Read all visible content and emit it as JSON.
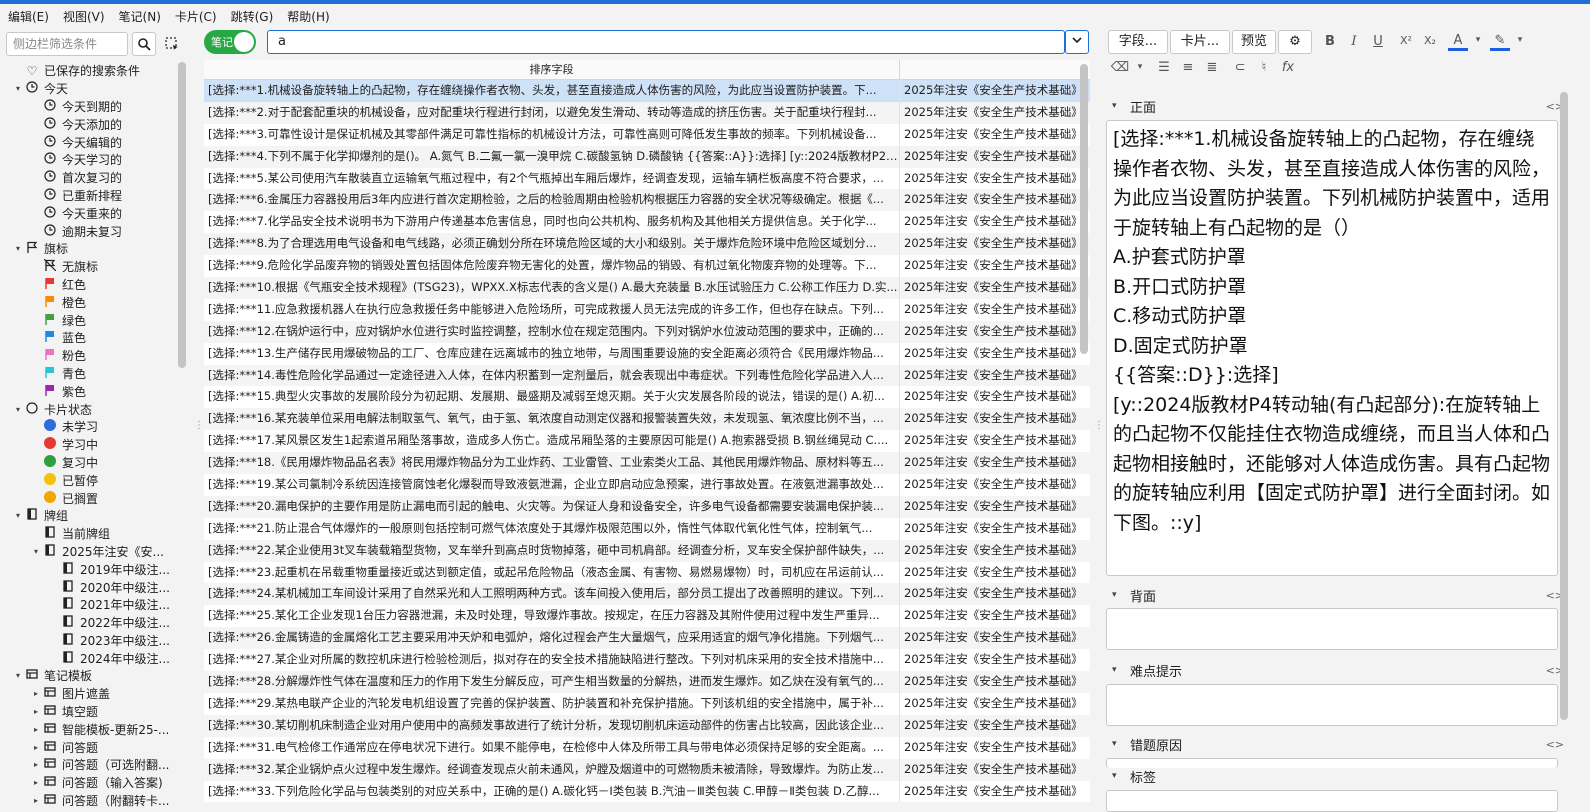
{
  "menu": [
    "编辑(E)",
    "视图(V)",
    "笔记(N)",
    "卡片(C)",
    "跳转(G)",
    "帮助(H)"
  ],
  "sidebar": {
    "search_placeholder": "侧边栏筛选条件",
    "items": [
      {
        "label": "已保存的搜索条件",
        "indent": 0,
        "arrow": "",
        "icon": "heart-icon"
      },
      {
        "label": "今天",
        "indent": 0,
        "arrow": "▾",
        "icon": "clock-icon"
      },
      {
        "label": "今天到期的",
        "indent": 1,
        "arrow": "",
        "icon": "clock-icon"
      },
      {
        "label": "今天添加的",
        "indent": 1,
        "arrow": "",
        "icon": "clock-icon"
      },
      {
        "label": "今天编辑的",
        "indent": 1,
        "arrow": "",
        "icon": "clock-icon"
      },
      {
        "label": "今天学习的",
        "indent": 1,
        "arrow": "",
        "icon": "clock-icon"
      },
      {
        "label": "首次复习的",
        "indent": 1,
        "arrow": "",
        "icon": "clock-icon"
      },
      {
        "label": "已重新排程",
        "indent": 1,
        "arrow": "",
        "icon": "clock-icon"
      },
      {
        "label": "今天重来的",
        "indent": 1,
        "arrow": "",
        "icon": "clock-icon"
      },
      {
        "label": "逾期未复习",
        "indent": 1,
        "arrow": "",
        "icon": "clock-icon"
      },
      {
        "label": "旗标",
        "indent": 0,
        "arrow": "▾",
        "icon": "flag-icon"
      },
      {
        "label": "无旗标",
        "indent": 1,
        "arrow": "",
        "icon": "no-flag-icon"
      },
      {
        "label": "红色",
        "indent": 1,
        "arrow": "",
        "icon": "red-flag-icon"
      },
      {
        "label": "橙色",
        "indent": 1,
        "arrow": "",
        "icon": "orange-flag-icon"
      },
      {
        "label": "绿色",
        "indent": 1,
        "arrow": "",
        "icon": "green-flag-icon"
      },
      {
        "label": "蓝色",
        "indent": 1,
        "arrow": "",
        "icon": "blue-flag-icon"
      },
      {
        "label": "粉色",
        "indent": 1,
        "arrow": "",
        "icon": "pink-flag-icon"
      },
      {
        "label": "青色",
        "indent": 1,
        "arrow": "",
        "icon": "cyan-flag-icon"
      },
      {
        "label": "紫色",
        "indent": 1,
        "arrow": "",
        "icon": "purple-flag-icon"
      },
      {
        "label": "卡片状态",
        "indent": 0,
        "arrow": "▾",
        "icon": "circle-icon"
      },
      {
        "label": "未学习",
        "indent": 1,
        "arrow": "",
        "icon": "blue-dot-icon"
      },
      {
        "label": "学习中",
        "indent": 1,
        "arrow": "",
        "icon": "red-dot-icon"
      },
      {
        "label": "复习中",
        "indent": 1,
        "arrow": "",
        "icon": "green-dot-icon"
      },
      {
        "label": "已暂停",
        "indent": 1,
        "arrow": "",
        "icon": "yellow-dot-icon"
      },
      {
        "label": "已搁置",
        "indent": 1,
        "arrow": "",
        "icon": "amber-dot-icon"
      },
      {
        "label": "牌组",
        "indent": 0,
        "arrow": "▾",
        "icon": "deck-icon"
      },
      {
        "label": "当前牌组",
        "indent": 1,
        "arrow": "",
        "icon": "deck-icon"
      },
      {
        "label": "2025年注安《安...",
        "indent": 1,
        "arrow": "▾",
        "icon": "deck-icon"
      },
      {
        "label": "2019年中级注...",
        "indent": 2,
        "arrow": "",
        "icon": "deck-icon"
      },
      {
        "label": "2020年中级注...",
        "indent": 2,
        "arrow": "",
        "icon": "deck-icon"
      },
      {
        "label": "2021年中级注...",
        "indent": 2,
        "arrow": "",
        "icon": "deck-icon"
      },
      {
        "label": "2022年中级注...",
        "indent": 2,
        "arrow": "",
        "icon": "deck-icon"
      },
      {
        "label": "2023年中级注...",
        "indent": 2,
        "arrow": "",
        "icon": "deck-icon"
      },
      {
        "label": "2024年中级注...",
        "indent": 2,
        "arrow": "",
        "icon": "deck-icon"
      },
      {
        "label": "笔记模板",
        "indent": 0,
        "arrow": "▾",
        "icon": "notetype-icon"
      },
      {
        "label": "图片遮盖",
        "indent": 1,
        "arrow": "▸",
        "icon": "notetype-icon"
      },
      {
        "label": "填空题",
        "indent": 1,
        "arrow": "▸",
        "icon": "notetype-icon"
      },
      {
        "label": "智能模板-更新25-...",
        "indent": 1,
        "arrow": "▸",
        "icon": "notetype-icon"
      },
      {
        "label": "问答题",
        "indent": 1,
        "arrow": "▸",
        "icon": "notetype-icon"
      },
      {
        "label": "问答题（可选附翻...",
        "indent": 1,
        "arrow": "▸",
        "icon": "notetype-icon"
      },
      {
        "label": "问答题（输入答案)",
        "indent": 1,
        "arrow": "▸",
        "icon": "notetype-icon"
      },
      {
        "label": "问答题（附翻转卡...",
        "indent": 1,
        "arrow": "▸",
        "icon": "notetype-icon"
      }
    ]
  },
  "toggle_label": "笔记",
  "search_value": "a",
  "table": {
    "header_sort_field": "排序字段",
    "rows": [
      {
        "field": "[选择:***1.机械设备旋转轴上的凸起物，存在缠绕操作者衣物、头发，甚至直接造成人体伤害的风险，为此应当设置防护装置。下...",
        "deck": "2025年注安《安全生产技术基础》"
      },
      {
        "field": "[选择:***2.对于配套配重块的机械设备，应对配重块行程进行封闭，以避免发生滑动、转动等造成的挤压伤害。关于配重块行程封...",
        "deck": "2025年注安《安全生产技术基础》"
      },
      {
        "field": "[选择:***3.可靠性设计是保证机械及其零部件满足可靠性指标的机械设计方法，可靠性高则可降低发生事故的频率。下列机械设备...",
        "deck": "2025年注安《安全生产技术基础》"
      },
      {
        "field": "[选择:***4.下列不属于化学抑爆剂的是()。 A.氮气 B.二氟一氯一溴甲烷 C.碳酸氢钠 D.磷酸钠 {{答案::A}}:选择] [y::2024版教材P284...",
        "deck": "2025年注安《安全生产技术基础》"
      },
      {
        "field": "[选择:***5.某公司使用汽车散装直立运输氧气瓶过程中，有2个气瓶掉出车厢后爆炸，经调查发现，运输车辆栏板高度不符合要求，...",
        "deck": "2025年注安《安全生产技术基础》"
      },
      {
        "field": "[选择:***6.金属压力容器投用后3年内应进行首次定期检验，之后的检验周期由检验机构根据压力容器的安全状况等级确定。根据《...",
        "deck": "2025年注安《安全生产技术基础》"
      },
      {
        "field": "[选择:***7.化学品安全技术说明书为下游用户传递基本危害信息，同时也向公共机构、服务机构及其他相关方提供信息。关于化学...",
        "deck": "2025年注安《安全生产技术基础》"
      },
      {
        "field": "[选择:***8.为了合理选用电气设备和电气线路，必须正确划分所在环境危险区域的大小和级别。关于爆炸危险环境中危险区域划分...",
        "deck": "2025年注安《安全生产技术基础》"
      },
      {
        "field": "[选择:***9.危险化学品废弃物的销毁处置包括固体危险废弃物无害化的处置，爆炸物品的销毁、有机过氧化物废弃物的处理等。下...",
        "deck": "2025年注安《安全生产技术基础》"
      },
      {
        "field": "[选择:***10.根据《气瓶安全技术规程》(TSG23)，WPXX.X标志代表的含义是() A.最大充装量 B.水压试验压力 C.公称工作压力 D.实...",
        "deck": "2025年注安《安全生产技术基础》"
      },
      {
        "field": "[选择:***11.应急救援机器人在执行应急救援任务中能够进入危险场所，可完成救援人员无法完成的许多工作，但也存在缺点。下列...",
        "deck": "2025年注安《安全生产技术基础》"
      },
      {
        "field": "[选择:***12.在锅炉运行中，应对锅炉水位进行实时监控调整，控制水位在规定范围内。下列对锅炉水位波动范围的要求中，正确的...",
        "deck": "2025年注安《安全生产技术基础》"
      },
      {
        "field": "[选择:***13.生产储存民用爆破物品的工厂、仓库应建在远离城市的独立地带，与周围重要设施的安全距离必须符合《民用爆炸物品...",
        "deck": "2025年注安《安全生产技术基础》"
      },
      {
        "field": "[选择:***14.毒性危险化学品通过一定途径进入人体，在体内积蓄到一定剂量后，就会表现出中毒症状。下列毒性危险化学品进入人...",
        "deck": "2025年注安《安全生产技术基础》"
      },
      {
        "field": "[选择:***15.典型火灾事故的发展阶段分为初起期、发展期、最盛期及减弱至熄灭期。关于火灾发展各阶段的说法，错误的是() A.初...",
        "deck": "2025年注安《安全生产技术基础》"
      },
      {
        "field": "[选择:***16.某充装单位采用电解法制取氢气、氧气，由于氢、氧浓度自动测定仪器和报警装置失效，未发现氢、氧浓度比例不当，...",
        "deck": "2025年注安《安全生产技术基础》"
      },
      {
        "field": "[选择:***17.某风景区发生1起索道吊厢坠落事故，造成多人伤亡。造成吊厢坠落的主要原因可能是() A.抱索器受损 B.钢丝绳晃动 C....",
        "deck": "2025年注安《安全生产技术基础》"
      },
      {
        "field": "[选择:***18.《民用爆炸物品品名表》将民用爆炸物品分为工业炸药、工业雷管、工业索类火工品、其他民用爆炸物品、原材料等五...",
        "deck": "2025年注安《安全生产技术基础》"
      },
      {
        "field": "[选择:***19.某公司氯制冷系统因连接管腐蚀老化爆裂而导致液氨泄漏，企业立即启动应急预案，进行事故处置。在液氨泄漏事故处...",
        "deck": "2025年注安《安全生产技术基础》"
      },
      {
        "field": "[选择:***20.漏电保护的主要作用是防止漏电而引起的触电、火灾等。为保证人身和设备安全，许多电气设备都需要安装漏电保护装...",
        "deck": "2025年注安《安全生产技术基础》"
      },
      {
        "field": "[选择:***21.防止混合气体爆炸的一般原则包括控制可燃气体浓度处于其爆炸极限范围以外，惰性气体取代氧化性气体，控制氧气...",
        "deck": "2025年注安《安全生产技术基础》"
      },
      {
        "field": "[选择:***22.某企业使用3t叉车装载箱型货物，叉车举升到高点时货物掉落，砸中司机肩部。经调查分析，叉车安全保护部件缺失，...",
        "deck": "2025年注安《安全生产技术基础》"
      },
      {
        "field": "[选择:***23.起重机在吊载重物重量接近或达到额定值，或起吊危险物品（液态金属、有害物、易燃易爆物）时，司机应在吊运前认...",
        "deck": "2025年注安《安全生产技术基础》"
      },
      {
        "field": "[选择:***24.某机械加工车间设计采用了自然采光和人工照明两种方式。该车间投入使用后，部分员工提出了改善照明的建议。下列...",
        "deck": "2025年注安《安全生产技术基础》"
      },
      {
        "field": "[选择:***25.某化工企业发现1台压力容器泄漏，未及时处理，导致爆炸事故。按规定，在压力容器及其附件使用过程中发生严重异...",
        "deck": "2025年注安《安全生产技术基础》"
      },
      {
        "field": "[选择:***26.金属铸造的金属熔化工艺主要采用冲天炉和电弧炉，熔化过程会产生大量烟气，应采用适宜的烟气净化措施。下列烟气...",
        "deck": "2025年注安《安全生产技术基础》"
      },
      {
        "field": "[选择:***27.某企业对所属的数控机床进行检验检测后，拟对存在的安全技术措施缺陷进行整改。下列对机床采用的安全技术措施中...",
        "deck": "2025年注安《安全生产技术基础》"
      },
      {
        "field": "[选择:***28.分解爆炸性气体在温度和压力的作用下发生分解反应，可产生相当数量的分解热，进而发生爆炸。如乙炔在没有氧气的...",
        "deck": "2025年注安《安全生产技术基础》"
      },
      {
        "field": "[选择:***29.某热电联产企业的汽轮发电机组设置了完善的保护装置、防护装置和补充保护措施。下列该机组的安全措施中，属于补...",
        "deck": "2025年注安《安全生产技术基础》"
      },
      {
        "field": "[选择:***30.某切削机床制造企业对用户使用中的高频发事故进行了统计分析，发现切削机床运动部件的伤害占比较高，因此该企业...",
        "deck": "2025年注安《安全生产技术基础》"
      },
      {
        "field": "[选择:***31.电气检修工作通常应在停电状况下进行。如果不能停电，在检修中人体及所带工具与带电体必须保持足够的安全距离。...",
        "deck": "2025年注安《安全生产技术基础》"
      },
      {
        "field": "[选择:***32.某企业锅炉点火过程中发生爆炸。经调查发现点火前未通风，炉膛及烟道中的可燃物质未被清除，导致爆炸。为防止发...",
        "deck": "2025年注安《安全生产技术基础》"
      },
      {
        "field": "[选择:***33.下列危险化学品与包装类别的对应关系中，正确的是() A.碳化钙－Ⅰ类包装 B.汽油－Ⅲ类包装 C.甲醇－Ⅱ类包装 D.乙醇...",
        "deck": "2025年注安《安全生产技术基础》"
      },
      {
        "field": "",
        "deck": ""
      }
    ]
  },
  "editor": {
    "buttons": {
      "fields": "字段...",
      "cards": "卡片...",
      "preview": "预览"
    },
    "fields": {
      "front": {
        "label": "正面",
        "content": [
          "[选择:***1.机械设备旋转轴上的凸起物，存在缠绕操作者衣物、头发，甚至直接造成人体伤害的风险，为此应当设置防护装置。下列机械防护装置中，适用于旋转轴上有凸起物的是（）",
          "A.护套式防护罩",
          "B.开口式防护罩",
          "C.移动式防护罩",
          "D.固定式防护罩",
          "{{答案::D}}:选择]",
          "[y::2024版教材P4转动轴(有凸起部分):在旋转轴上的凸起物不仅能挂住衣物造成缠绕，而且当人体和凸起物相接触时，还能够对人体造成伤害。具有凸起物的旋转轴应利用【固定式防护罩】进行全面封闭。如下图。::y]"
        ]
      },
      "back": {
        "label": "背面"
      },
      "hint": {
        "label": "难点提示"
      },
      "wrong_reason": {
        "label": "错题原因"
      },
      "tags": {
        "label": "标签"
      }
    },
    "code_icon": "<>"
  },
  "colors": {
    "accent": "#1f6fd6",
    "toggle": "#27a844",
    "selected_row": "#cfe1f7",
    "flags": {
      "red": "#e53935",
      "orange": "#fb8c00",
      "green": "#43a047",
      "blue": "#1e88e5",
      "pink": "#ec72c6",
      "cyan": "#26c6da",
      "purple": "#9c27b0"
    },
    "states": {
      "new": "#2d6cdf",
      "learning": "#e53935",
      "review": "#2e9e3e",
      "suspended": "#f4c20d",
      "buried": "#f0a800"
    }
  }
}
